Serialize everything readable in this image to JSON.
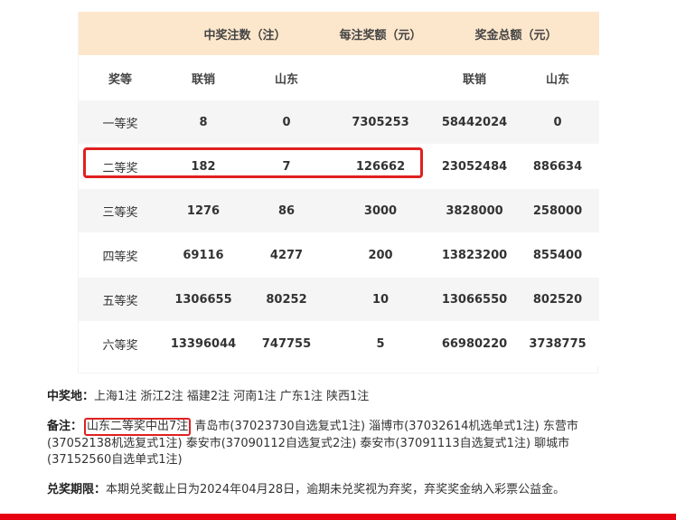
{
  "table": {
    "header_group": {
      "winners": "中奖注数（注）",
      "prize_per": "每注奖额（元）",
      "total": "奖金总额（元）"
    },
    "header_sub": {
      "level": "奖等",
      "lianxiao": "联销",
      "shandong": "山东",
      "lianxiao2": "联销",
      "shandong2": "山东"
    },
    "rows": [
      {
        "level": "一等奖",
        "win_lx": "8",
        "win_sd": "0",
        "per": "7305253",
        "tot_lx": "58442024",
        "tot_sd": "0"
      },
      {
        "level": "二等奖",
        "win_lx": "182",
        "win_sd": "7",
        "per": "126662",
        "tot_lx": "23052484",
        "tot_sd": "886634"
      },
      {
        "level": "三等奖",
        "win_lx": "1276",
        "win_sd": "86",
        "per": "3000",
        "tot_lx": "3828000",
        "tot_sd": "258000"
      },
      {
        "level": "四等奖",
        "win_lx": "69116",
        "win_sd": "4277",
        "per": "200",
        "tot_lx": "13823200",
        "tot_sd": "855400"
      },
      {
        "level": "五等奖",
        "win_lx": "1306655",
        "win_sd": "80252",
        "per": "10",
        "tot_lx": "13066550",
        "tot_sd": "802520"
      },
      {
        "level": "六等奖",
        "win_lx": "13396044",
        "win_sd": "747755",
        "per": "5",
        "tot_lx": "66980220",
        "tot_sd": "3738775"
      }
    ]
  },
  "notes": {
    "winners_label": "中奖地：",
    "winners_text": "上海1注 浙江2注 福建2注 河南1注 广东1注 陕西1注",
    "remark_label": "备注：",
    "remark_boxed": "山东二等奖中出7注",
    "remark_rest": " 青岛市(37023730自选复式1注) 淄博市(37032614机选单式1注) 东营市(37052138机选复式1注) 泰安市(37090112自选复式2注) 泰安市(37091113自选复式1注) 聊城市(37152560自选单式1注)",
    "deadline_label": "兑奖期限：",
    "deadline_text": "本期兑奖截止日为2024年04月28日，逾期未兑奖视为弃奖，弃奖奖金纳入彩票公益金。"
  },
  "colors": {
    "header_bg": "#fde7cc",
    "stripe_bg": "#f5f5f5",
    "highlight": "#e02020",
    "bottom_bar": "#e60012"
  }
}
